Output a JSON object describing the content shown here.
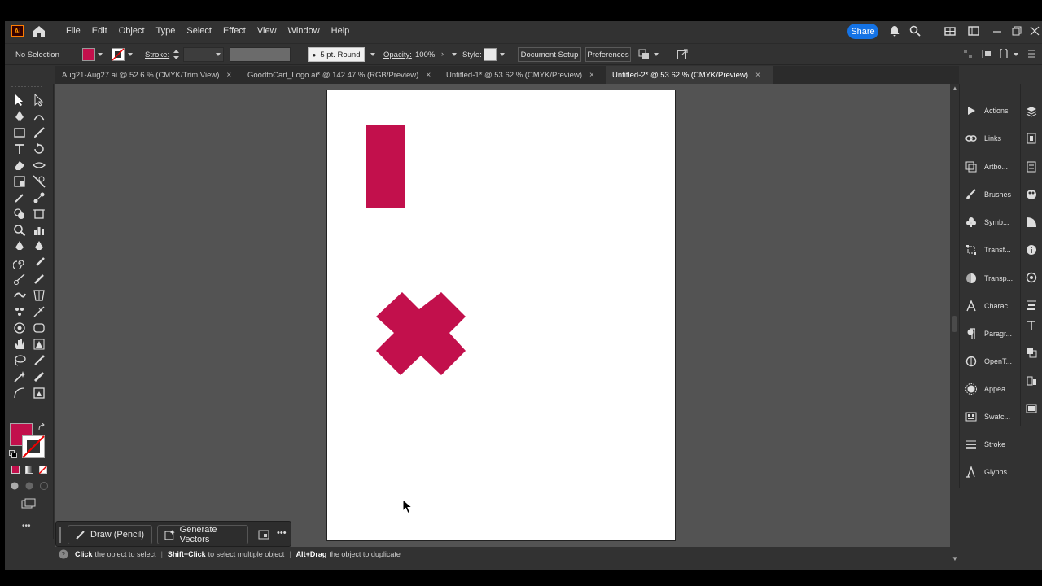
{
  "app": {
    "logo": "Ai",
    "menu": [
      "File",
      "Edit",
      "Object",
      "Type",
      "Select",
      "Effect",
      "View",
      "Window",
      "Help"
    ],
    "share_label": "Share"
  },
  "control_bar": {
    "selection": "No Selection",
    "stroke_label": "Stroke:",
    "brush": "5 pt. Round",
    "opacity_label": "Opacity:",
    "opacity_value": "100%",
    "style_label": "Style:",
    "document_setup": "Document Setup",
    "preferences": "Preferences"
  },
  "tabs": [
    {
      "label": "Aug21-Aug27.ai @ 52.6 % (CMYK/Trim View)",
      "active": false
    },
    {
      "label": "GoodtoCart_Logo.ai* @ 142.47 % (RGB/Preview)",
      "active": false
    },
    {
      "label": "Untitled-1* @ 53.62 % (CMYK/Preview)",
      "active": false
    },
    {
      "label": "Untitled-2* @ 53.62 % (CMYK/Preview)",
      "active": true
    }
  ],
  "tab_close": "×",
  "colors": {
    "fill": "#c2104c",
    "accent": "#1473e6"
  },
  "context_bar": {
    "draw_mode": "Draw (Pencil)",
    "generate": "Generate Vectors",
    "more": "•••"
  },
  "status": {
    "hint1_key": "Click",
    "hint1_text": "the object to select",
    "hint2_key": "Shift+Click",
    "hint2_text": "to select multiple object",
    "hint3_key": "Alt+Drag",
    "hint3_text": "the object to duplicate",
    "separator": "|"
  },
  "panels": [
    {
      "label": "Actions",
      "icon": "play-icon"
    },
    {
      "label": "Links",
      "icon": "link-icon"
    },
    {
      "label": "Artbo...",
      "icon": "artboards-icon"
    },
    {
      "label": "Brushes",
      "icon": "brush-icon"
    },
    {
      "label": "Symb...",
      "icon": "symbols-icon"
    },
    {
      "label": "Transf...",
      "icon": "transform-icon"
    },
    {
      "label": "Transp...",
      "icon": "transparency-icon"
    },
    {
      "label": "Charac...",
      "icon": "character-icon"
    },
    {
      "label": "Paragr...",
      "icon": "paragraph-icon"
    },
    {
      "label": "OpenT...",
      "icon": "opentype-icon"
    },
    {
      "label": "Appea...",
      "icon": "appearance-icon"
    },
    {
      "label": "Swatc...",
      "icon": "swatches-icon"
    },
    {
      "label": "Stroke",
      "icon": "stroke-icon"
    },
    {
      "label": "Glyphs",
      "icon": "glyphs-icon"
    }
  ],
  "toolbar_more": "•••"
}
